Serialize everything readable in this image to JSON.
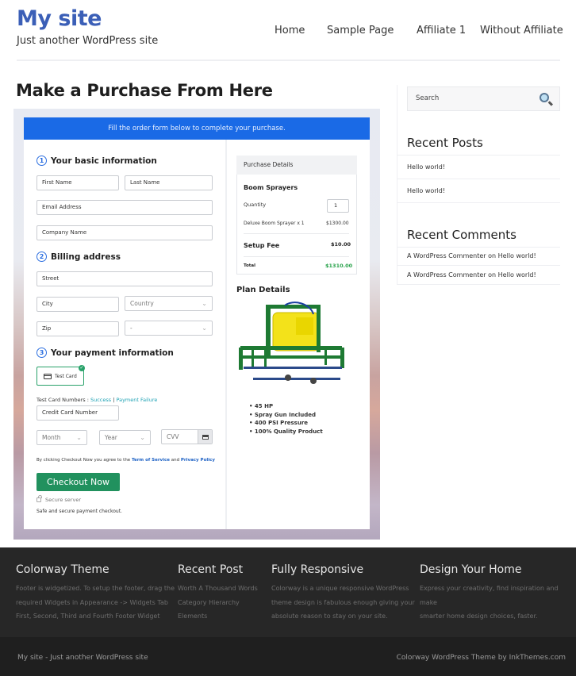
{
  "header": {
    "site_title": "My site",
    "tagline": "Just another WordPress site",
    "nav": [
      "Home",
      "Sample Page",
      "Affiliate 1",
      "Without Affiliate"
    ]
  },
  "page": {
    "title": "Make a Purchase From Here"
  },
  "checkout": {
    "banner": "Fill the order form below to complete your purchase.",
    "steps": {
      "basic": {
        "num": "1",
        "label": "Your basic information"
      },
      "billing": {
        "num": "2",
        "label": "Billing address"
      },
      "payment": {
        "num": "3",
        "label": "Your payment information"
      }
    },
    "fields": {
      "first_name": "First Name",
      "last_name": "Last Name",
      "email": "Email Address",
      "company": "Company Name",
      "street": "Street",
      "city": "City",
      "country": "Country",
      "zip": "Zip",
      "state": "-",
      "card_number": "Credit Card Number",
      "month": "Month",
      "year": "Year",
      "cvv": "CVV"
    },
    "payment_option": "Test Card",
    "test_numbers_label": "Test Card Numbers : ",
    "test_success": "Success",
    "test_sep": " | ",
    "test_failure": "Payment Failure",
    "agree_prefix": "By clicking Checkout Now you agree to the ",
    "terms": "Term of Service",
    "agree_and": " and ",
    "privacy": "Privacy Policy",
    "checkout_button": "Checkout Now",
    "secure_server": "Secure server",
    "safe_text": "Safe and secure payment checkout."
  },
  "purchase_details": {
    "heading": "Purchase Details",
    "product": "Boom Sprayers",
    "quantity_label": "Quantity",
    "quantity": "1",
    "line_item": "Deluxe Boom Sprayer x 1",
    "line_price": "$1300.00",
    "setup_label": "Setup Fee",
    "setup_price": "$10.00",
    "total_label": "Total",
    "total_price": "$1310.00"
  },
  "plan": {
    "title": "Plan Details",
    "features": [
      "45 HP",
      "Spray Gun Included",
      "400 PSI Pressure",
      "100% Quality Product"
    ]
  },
  "sidebar": {
    "search_placeholder": "Search",
    "recent_posts_title": "Recent Posts",
    "recent_posts": [
      "Hello world!",
      "Hello world!"
    ],
    "recent_comments_title": "Recent Comments",
    "recent_comments": [
      {
        "author": "A WordPress Commenter",
        "on": " on ",
        "post": "Hello world!"
      },
      {
        "author": "A WordPress Commenter",
        "on": " on ",
        "post": "Hello world!"
      }
    ]
  },
  "footer": {
    "col1": {
      "title": "Colorway Theme",
      "text": [
        "Footer is widgetized. To setup the footer, drag the",
        "required Widgets in Appearance -> Widgets Tab",
        "First, Second, Third and Fourth Footer Widget"
      ]
    },
    "col2": {
      "title": "Recent Post",
      "links": [
        "Worth A Thousand Words",
        "Category Hierarchy",
        "Elements"
      ]
    },
    "col3": {
      "title": "Fully Responsive",
      "text": [
        "Colorway is a unique responsive WordPress",
        "theme design is fabulous enough giving your",
        "absolute reason to stay on your site."
      ]
    },
    "col4": {
      "title": "Design Your Home",
      "text": [
        "Express your creativity, find inspiration and make",
        "smarter home design choices, faster."
      ]
    },
    "bottom_left": "My site - Just another WordPress site",
    "bottom_right": "Colorway WordPress Theme by InkThemes.com"
  },
  "colors": {
    "brand_blue": "#3b5fb7",
    "banner_blue": "#1a6ae6",
    "checkout_green": "#21915e",
    "total_green": "#27a24a"
  }
}
